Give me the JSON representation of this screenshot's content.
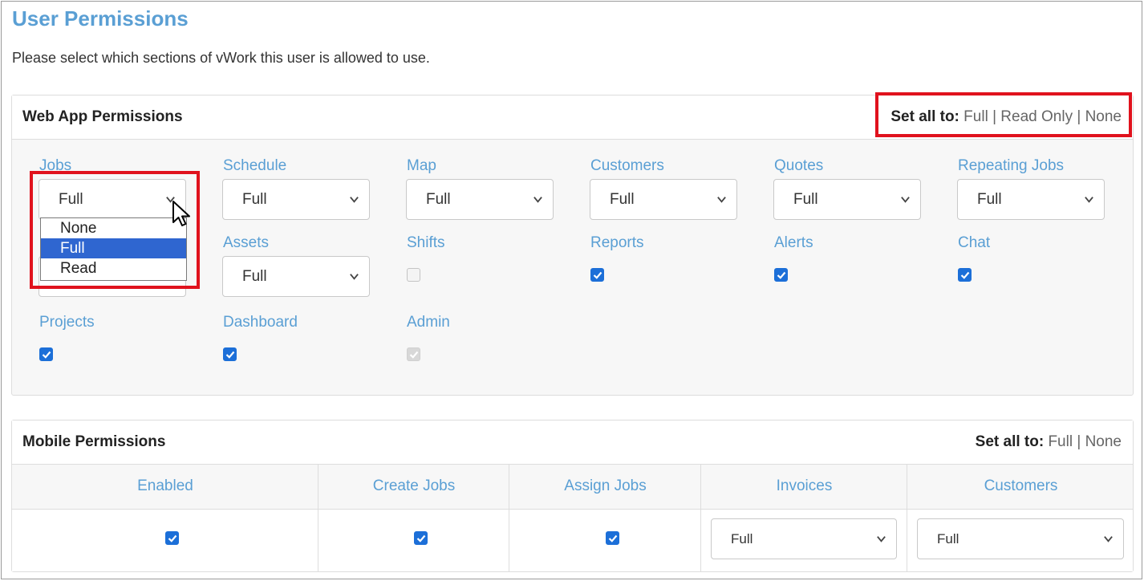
{
  "page": {
    "title": "User Permissions",
    "intro": "Please select which sections of vWork this user is allowed to use."
  },
  "web": {
    "title": "Web App Permissions",
    "set_all": {
      "label": "Set all to:",
      "options": [
        "Full",
        "Read Only",
        "None"
      ],
      "sep": "|"
    },
    "items": [
      {
        "label": "Jobs",
        "value": "Full"
      },
      {
        "label": "Schedule",
        "value": "Full"
      },
      {
        "label": "Map",
        "value": "Full"
      },
      {
        "label": "Customers",
        "value": "Full"
      },
      {
        "label": "Quotes",
        "value": "Full"
      },
      {
        "label": "Repeating Jobs",
        "value": "Full"
      },
      {
        "label": "Assets",
        "value": "Full"
      },
      {
        "label": "Shifts",
        "checked": false
      },
      {
        "label": "Reports",
        "checked": true
      },
      {
        "label": "Alerts",
        "checked": true
      },
      {
        "label": "Chat",
        "checked": true
      },
      {
        "label": "Projects",
        "checked": true
      },
      {
        "label": "Dashboard",
        "checked": true
      },
      {
        "label": "Admin",
        "checked": true,
        "disabled": true
      }
    ],
    "jobs_dropdown": {
      "options": [
        "None",
        "Full",
        "Read"
      ],
      "selected": "Full"
    }
  },
  "mobile": {
    "title": "Mobile Permissions",
    "set_all": {
      "label": "Set all to:",
      "options": [
        "Full",
        "None"
      ],
      "sep": "|"
    },
    "columns": [
      "Enabled",
      "Create Jobs",
      "Assign Jobs",
      "Invoices",
      "Customers"
    ],
    "row": {
      "enabled": true,
      "create_jobs": true,
      "assign_jobs": true,
      "invoices": "Full",
      "customers": "Full"
    }
  },
  "colors": {
    "accent": "#5a9fd4",
    "checkbox": "#1c6fd8",
    "highlight": "#e0121d",
    "selected_option": "#2f66d0"
  },
  "icons": {
    "chevron": "chevron-down-icon",
    "check": "check-icon",
    "cursor": "mouse-pointer-icon"
  }
}
